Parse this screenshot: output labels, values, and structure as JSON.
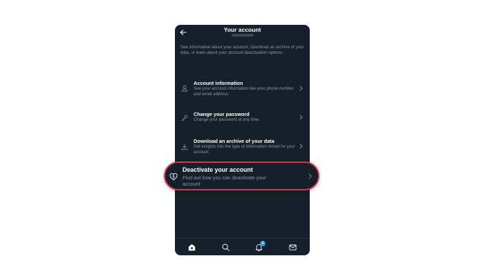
{
  "header": {
    "title": "Your account"
  },
  "intro": {
    "text": "See information about your account, download an archive of your data, or learn about your account deactivation options."
  },
  "menu": [
    {
      "title": "Account information",
      "description": "See your account information like your phone number and email address.",
      "icon": "person-icon"
    },
    {
      "title": "Change your password",
      "description": "Change your password at any time.",
      "icon": "key-icon"
    },
    {
      "title": "Download an archive of your data",
      "description": "Get insights into the type of information stored for your account.",
      "icon": "download-icon"
    }
  ],
  "highlighted": {
    "title": "Deactivate your account",
    "description": "Find out how you can deactivate your account",
    "icon": "broken-heart-icon",
    "border_color": "#d63a4e"
  },
  "tabbar": {
    "items": [
      "home-icon",
      "search-icon",
      "bell-icon",
      "mail-icon"
    ],
    "notifications_badge": "3"
  },
  "colors": {
    "background": "#15202b",
    "text_primary": "#ffffff",
    "text_secondary": "#8b98a5",
    "accent": "#1d9bf0"
  }
}
